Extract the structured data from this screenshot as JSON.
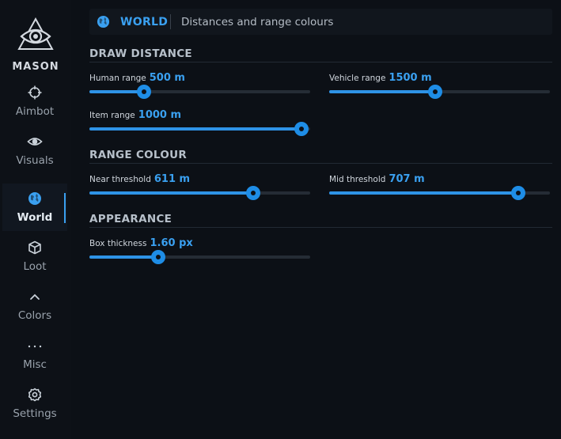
{
  "brand": {
    "name": "MASON"
  },
  "nav": [
    {
      "id": "aimbot",
      "label": "Aimbot",
      "icon": "crosshair-icon",
      "active": false
    },
    {
      "id": "visuals",
      "label": "Visuals",
      "icon": "eye-icon",
      "active": false
    },
    {
      "id": "world",
      "label": "World",
      "icon": "globe-icon",
      "active": true
    },
    {
      "id": "loot",
      "label": "Loot",
      "icon": "box-icon",
      "active": false
    },
    {
      "id": "colors",
      "label": "Colors",
      "icon": "chevron-up-icon",
      "active": false
    },
    {
      "id": "misc",
      "label": "Misc",
      "icon": "dots-icon",
      "active": false
    },
    {
      "id": "settings",
      "label": "Settings",
      "icon": "gear-icon",
      "active": false
    }
  ],
  "header": {
    "title": "WORLD",
    "subtitle": "Distances and range colours"
  },
  "sections": {
    "draw_distance": {
      "title": "DRAW DISTANCE",
      "human": {
        "label": "Human range",
        "value": "500 m",
        "fill": 0.247
      },
      "vehicle": {
        "label": "Vehicle range",
        "value": "1500 m",
        "fill": 0.48
      },
      "item": {
        "label": "Item range",
        "value": "1000 m",
        "fill": 0.96
      }
    },
    "range_colour": {
      "title": "RANGE COLOUR",
      "near": {
        "label": "Near threshold",
        "value": "611 m",
        "fill": 0.743
      },
      "mid": {
        "label": "Mid threshold",
        "value": "707 m",
        "fill": 0.857
      }
    },
    "appearance": {
      "title": "APPEARANCE",
      "box": {
        "label": "Box thickness",
        "value": "1.60 px",
        "fill": 0.312
      }
    }
  },
  "colors": {
    "accent": "#3aa0f0",
    "background": "#0c1016",
    "track": "#252c35"
  }
}
